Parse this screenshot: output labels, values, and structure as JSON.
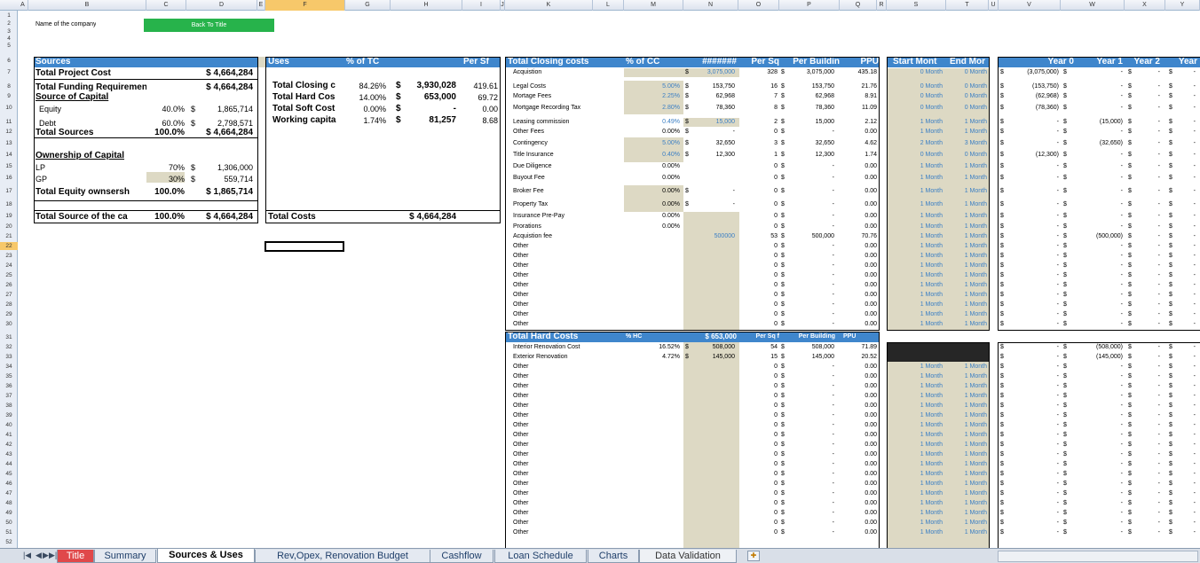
{
  "columns": [
    "A",
    "B",
    "C",
    "D",
    "E",
    "F",
    "G",
    "H",
    "I",
    "J",
    "K",
    "L",
    "M",
    "N",
    "O",
    "P",
    "Q",
    "R",
    "S",
    "T",
    "U",
    "V",
    "W",
    "X",
    "Y"
  ],
  "rows": [
    "1",
    "2",
    "3",
    "4",
    "5",
    "6",
    "7",
    "8",
    "9",
    "10",
    "11",
    "12",
    "13",
    "14",
    "15",
    "16",
    "17",
    "18",
    "19",
    "20",
    "21",
    "22",
    "23",
    "24",
    "25",
    "26",
    "27",
    "28",
    "29",
    "30",
    "31",
    "32",
    "33",
    "34",
    "35",
    "36",
    "37",
    "38",
    "39",
    "40",
    "41",
    "42",
    "43",
    "44",
    "45",
    "46",
    "47",
    "48",
    "49",
    "50",
    "51",
    "52"
  ],
  "company_label": "Name of the company",
  "back_button": "Back To Title",
  "sources": {
    "header": "Sources",
    "rows": [
      {
        "label": "Total Project Cost",
        "pct": "",
        "d": "",
        "val": "$ 4,664,284"
      },
      {
        "label": "Total Funding Requirement",
        "pct": "",
        "d": "",
        "val": "$ 4,664,284"
      },
      {
        "label": "Source of Capital",
        "pct": "",
        "d": "",
        "val": ""
      },
      {
        "label": "Equity",
        "pct": "40.0%",
        "d": "$",
        "val": "1,865,714"
      },
      {
        "label": "Debt",
        "pct": "60.0%",
        "d": "$",
        "val": "2,798,571"
      },
      {
        "label": "Total Sources",
        "pct": "100.0%",
        "d": "",
        "val": "$ 4,664,284"
      },
      {
        "label": "Ownership of Capital",
        "pct": "",
        "d": "",
        "val": ""
      },
      {
        "label": "LP",
        "pct": "70%",
        "d": "$",
        "val": "1,306,000"
      },
      {
        "label": "GP",
        "pct": "30%",
        "d": "$",
        "val": "559,714"
      },
      {
        "label": "Total Equity ownsersh",
        "pct": "100.0%",
        "d": "",
        "val": "$ 1,865,714"
      },
      {
        "label": "Total Source of the ca",
        "pct": "100.0%",
        "d": "",
        "val": "$ 4,664,284"
      }
    ]
  },
  "uses": {
    "header": "Uses",
    "pct_header": "% of TC",
    "persf_header": "Per Sf",
    "rows": [
      {
        "label": "Total Closing c",
        "pct": "84.26%",
        "d": "$",
        "val": "3,930,028",
        "psf": "419.61"
      },
      {
        "label": "Total Hard Cos",
        "pct": "14.00%",
        "d": "$",
        "val": "653,000",
        "psf": "69.72"
      },
      {
        "label": "Total Soft Cost",
        "pct": "0.00%",
        "d": "$",
        "val": "-",
        "psf": "0.00"
      },
      {
        "label": "Working capita",
        "pct": "1.74%",
        "d": "$",
        "val": "81,257",
        "psf": "8.68"
      }
    ],
    "total_label": "Total Costs",
    "total_val": "$ 4,664,284"
  },
  "closing": {
    "header": "Total Closing costs",
    "cols": [
      "% of CC",
      "#######",
      "Per Sq",
      "Per Buildin",
      "PPU"
    ],
    "rows": [
      {
        "label": "Acquistion",
        "pct": "",
        "d": "$",
        "amt": "3,075,000",
        "sq": "328",
        "d2": "$",
        "bld": "3,075,000",
        "ppu": "435.18"
      },
      {
        "label": "Legal Costs",
        "pct": "5.00%",
        "d": "$",
        "amt": "153,750",
        "sq": "16",
        "d2": "$",
        "bld": "153,750",
        "ppu": "21.76"
      },
      {
        "label": "Mortage Fees",
        "pct": "2.25%",
        "d": "$",
        "amt": "62,968",
        "sq": "7",
        "d2": "$",
        "bld": "62,968",
        "ppu": "8.91"
      },
      {
        "label": "Mortgage Recording Tax",
        "pct": "2.80%",
        "d": "$",
        "amt": "78,360",
        "sq": "8",
        "d2": "$",
        "bld": "78,360",
        "ppu": "11.09"
      },
      {
        "label": "Leasing commission",
        "pct": "0.49%",
        "d": "$",
        "amt": "15,000",
        "sq": "2",
        "d2": "$",
        "bld": "15,000",
        "ppu": "2.12"
      },
      {
        "label": "Other Fees",
        "pct": "0.00%",
        "d": "$",
        "amt": "-",
        "sq": "0",
        "d2": "$",
        "bld": "-",
        "ppu": "0.00"
      },
      {
        "label": "Contingency",
        "pct": "5.00%",
        "d": "$",
        "amt": "32,650",
        "sq": "3",
        "d2": "$",
        "bld": "32,650",
        "ppu": "4.62"
      },
      {
        "label": "Title Insurance",
        "pct": "0.40%",
        "d": "$",
        "amt": "12,300",
        "sq": "1",
        "d2": "$",
        "bld": "12,300",
        "ppu": "1.74"
      },
      {
        "label": "Due Diligence",
        "pct": "0.00%",
        "d": "",
        "amt": "",
        "sq": "0",
        "d2": "$",
        "bld": "-",
        "ppu": "0.00"
      },
      {
        "label": "Buyout Fee",
        "pct": "0.00%",
        "d": "",
        "amt": "",
        "sq": "0",
        "d2": "$",
        "bld": "-",
        "ppu": "0.00"
      },
      {
        "label": "Broker Fee",
        "pct": "0.00%",
        "d": "$",
        "amt": "-",
        "sq": "0",
        "d2": "$",
        "bld": "-",
        "ppu": "0.00"
      },
      {
        "label": "Property Tax",
        "pct": "0.00%",
        "d": "$",
        "amt": "-",
        "sq": "0",
        "d2": "$",
        "bld": "-",
        "ppu": "0.00"
      },
      {
        "label": "Insurance Pre-Pay",
        "pct": "0.00%",
        "d": "",
        "amt": "",
        "sq": "0",
        "d2": "$",
        "bld": "-",
        "ppu": "0.00"
      },
      {
        "label": "Prorations",
        "pct": "0.00%",
        "d": "",
        "amt": "",
        "sq": "0",
        "d2": "$",
        "bld": "-",
        "ppu": "0.00"
      },
      {
        "label": "Acquistion fee",
        "pct": "",
        "d": "",
        "amt": "500000",
        "sq": "53",
        "d2": "$",
        "bld": "500,000",
        "ppu": "70.76"
      },
      {
        "label": "Other",
        "pct": "",
        "d": "",
        "amt": "",
        "sq": "0",
        "d2": "$",
        "bld": "-",
        "ppu": "0.00"
      },
      {
        "label": "Other",
        "pct": "",
        "d": "",
        "amt": "",
        "sq": "0",
        "d2": "$",
        "bld": "-",
        "ppu": "0.00"
      },
      {
        "label": "Other",
        "pct": "",
        "d": "",
        "amt": "",
        "sq": "0",
        "d2": "$",
        "bld": "-",
        "ppu": "0.00"
      },
      {
        "label": "Other",
        "pct": "",
        "d": "",
        "amt": "",
        "sq": "0",
        "d2": "$",
        "bld": "-",
        "ppu": "0.00"
      },
      {
        "label": "Other",
        "pct": "",
        "d": "",
        "amt": "",
        "sq": "0",
        "d2": "$",
        "bld": "-",
        "ppu": "0.00"
      },
      {
        "label": "Other",
        "pct": "",
        "d": "",
        "amt": "",
        "sq": "0",
        "d2": "$",
        "bld": "-",
        "ppu": "0.00"
      },
      {
        "label": "Other",
        "pct": "",
        "d": "",
        "amt": "",
        "sq": "0",
        "d2": "$",
        "bld": "-",
        "ppu": "0.00"
      },
      {
        "label": "Other",
        "pct": "",
        "d": "",
        "amt": "",
        "sq": "0",
        "d2": "$",
        "bld": "-",
        "ppu": "0.00"
      },
      {
        "label": "Other",
        "pct": "",
        "d": "",
        "amt": "",
        "sq": "0",
        "d2": "$",
        "bld": "-",
        "ppu": "0.00"
      }
    ]
  },
  "hard": {
    "header": "Total Hard Costs",
    "cols": [
      "% HC",
      "$ 653,000",
      "Per Sq f",
      "Per Building",
      "PPU"
    ],
    "rows": [
      {
        "label": "Interior Renovation Cost",
        "pct": "16.52%",
        "d": "$",
        "amt": "508,000",
        "sq": "54",
        "d2": "$",
        "bld": "508,000",
        "ppu": "71.89"
      },
      {
        "label": "Exterior Renovation",
        "pct": "4.72%",
        "d": "$",
        "amt": "145,000",
        "sq": "15",
        "d2": "$",
        "bld": "145,000",
        "ppu": "20.52"
      },
      {
        "label": "Other",
        "pct": "",
        "d": "",
        "amt": "",
        "sq": "0",
        "d2": "$",
        "bld": "-",
        "ppu": "0.00"
      },
      {
        "label": "Other",
        "pct": "",
        "d": "",
        "amt": "",
        "sq": "0",
        "d2": "$",
        "bld": "-",
        "ppu": "0.00"
      },
      {
        "label": "Other",
        "pct": "",
        "d": "",
        "amt": "",
        "sq": "0",
        "d2": "$",
        "bld": "-",
        "ppu": "0.00"
      },
      {
        "label": "Other",
        "pct": "",
        "d": "",
        "amt": "",
        "sq": "0",
        "d2": "$",
        "bld": "-",
        "ppu": "0.00"
      },
      {
        "label": "Other",
        "pct": "",
        "d": "",
        "amt": "",
        "sq": "0",
        "d2": "$",
        "bld": "-",
        "ppu": "0.00"
      },
      {
        "label": "Other",
        "pct": "",
        "d": "",
        "amt": "",
        "sq": "0",
        "d2": "$",
        "bld": "-",
        "ppu": "0.00"
      },
      {
        "label": "Other",
        "pct": "",
        "d": "",
        "amt": "",
        "sq": "0",
        "d2": "$",
        "bld": "-",
        "ppu": "0.00"
      },
      {
        "label": "Other",
        "pct": "",
        "d": "",
        "amt": "",
        "sq": "0",
        "d2": "$",
        "bld": "-",
        "ppu": "0.00"
      },
      {
        "label": "Other",
        "pct": "",
        "d": "",
        "amt": "",
        "sq": "0",
        "d2": "$",
        "bld": "-",
        "ppu": "0.00"
      },
      {
        "label": "Other",
        "pct": "",
        "d": "",
        "amt": "",
        "sq": "0",
        "d2": "$",
        "bld": "-",
        "ppu": "0.00"
      },
      {
        "label": "Other",
        "pct": "",
        "d": "",
        "amt": "",
        "sq": "0",
        "d2": "$",
        "bld": "-",
        "ppu": "0.00"
      },
      {
        "label": "Other",
        "pct": "",
        "d": "",
        "amt": "",
        "sq": "0",
        "d2": "$",
        "bld": "-",
        "ppu": "0.00"
      },
      {
        "label": "Other",
        "pct": "",
        "d": "",
        "amt": "",
        "sq": "0",
        "d2": "$",
        "bld": "-",
        "ppu": "0.00"
      },
      {
        "label": "Other",
        "pct": "",
        "d": "",
        "amt": "",
        "sq": "0",
        "d2": "$",
        "bld": "-",
        "ppu": "0.00"
      },
      {
        "label": "Other",
        "pct": "",
        "d": "",
        "amt": "",
        "sq": "0",
        "d2": "$",
        "bld": "-",
        "ppu": "0.00"
      },
      {
        "label": "Other",
        "pct": "",
        "d": "",
        "amt": "",
        "sq": "0",
        "d2": "$",
        "bld": "-",
        "ppu": "0.00"
      },
      {
        "label": "Other",
        "pct": "",
        "d": "",
        "amt": "",
        "sq": "0",
        "d2": "$",
        "bld": "-",
        "ppu": "0.00"
      },
      {
        "label": "Other",
        "pct": "",
        "d": "",
        "amt": "",
        "sq": "0",
        "d2": "$",
        "bld": "-",
        "ppu": "0.00"
      }
    ]
  },
  "timing": {
    "start_header": "Start Mont",
    "end_header": "End Mor",
    "closing": [
      [
        "0 Month",
        "0 Month"
      ],
      [
        "0 Month",
        "0 Month"
      ],
      [
        "0 Month",
        "0 Month"
      ],
      [
        "0 Month",
        "0 Month"
      ],
      [
        "1 Month",
        "1 Month"
      ],
      [
        "1 Month",
        "1 Month"
      ],
      [
        "2 Month",
        "3 Month"
      ],
      [
        "0 Month",
        "0 Month"
      ],
      [
        "1 Month",
        "1 Month"
      ],
      [
        "1 Month",
        "1 Month"
      ],
      [
        "1 Month",
        "1 Month"
      ],
      [
        "1 Month",
        "1 Month"
      ],
      [
        "1 Month",
        "1 Month"
      ],
      [
        "1 Month",
        "1 Month"
      ],
      [
        "1 Month",
        "1 Month"
      ],
      [
        "1 Month",
        "1 Month"
      ],
      [
        "1 Month",
        "1 Month"
      ],
      [
        "1 Month",
        "1 Month"
      ],
      [
        "1 Month",
        "1 Month"
      ],
      [
        "1 Month",
        "1 Month"
      ],
      [
        "1 Month",
        "1 Month"
      ],
      [
        "1 Month",
        "1 Month"
      ],
      [
        "1 Month",
        "1 Month"
      ],
      [
        "1 Month",
        "1 Month"
      ]
    ],
    "hard": [
      [
        "",
        ""
      ],
      [
        "",
        ""
      ],
      [
        "1 Month",
        "1 Month"
      ],
      [
        "1 Month",
        "1 Month"
      ],
      [
        "1 Month",
        "1 Month"
      ],
      [
        "1 Month",
        "1 Month"
      ],
      [
        "1 Month",
        "1 Month"
      ],
      [
        "1 Month",
        "1 Month"
      ],
      [
        "1 Month",
        "1 Month"
      ],
      [
        "1 Month",
        "1 Month"
      ],
      [
        "1 Month",
        "1 Month"
      ],
      [
        "1 Month",
        "1 Month"
      ],
      [
        "1 Month",
        "1 Month"
      ],
      [
        "1 Month",
        "1 Month"
      ],
      [
        "1 Month",
        "1 Month"
      ],
      [
        "1 Month",
        "1 Month"
      ],
      [
        "1 Month",
        "1 Month"
      ],
      [
        "1 Month",
        "1 Month"
      ],
      [
        "1 Month",
        "1 Month"
      ],
      [
        "1 Month",
        "1 Month"
      ]
    ]
  },
  "years": {
    "headers": [
      "Year 0",
      "Year 1",
      "Year 2",
      "Year"
    ],
    "closing": [
      [
        "(3,075,000)",
        "-"
      ],
      [
        "(153,750)",
        "-"
      ],
      [
        "(62,968)",
        "-"
      ],
      [
        "(78,360)",
        "-"
      ],
      [
        "-",
        "(15,000)"
      ],
      [
        "-",
        "-"
      ],
      [
        "-",
        "(32,650)"
      ],
      [
        "(12,300)",
        "-"
      ],
      [
        "-",
        "-"
      ],
      [
        "-",
        "-"
      ],
      [
        "-",
        "-"
      ],
      [
        "-",
        "-"
      ],
      [
        "-",
        "-"
      ],
      [
        "-",
        "-"
      ],
      [
        "-",
        "(500,000)"
      ],
      [
        "-",
        "-"
      ],
      [
        "-",
        "-"
      ],
      [
        "-",
        "-"
      ],
      [
        "-",
        "-"
      ],
      [
        "-",
        "-"
      ],
      [
        "-",
        "-"
      ],
      [
        "-",
        "-"
      ],
      [
        "-",
        "-"
      ],
      [
        "-",
        "-"
      ]
    ],
    "hard": [
      [
        "-",
        "(508,000)"
      ],
      [
        "-",
        "(145,000)"
      ],
      [
        "-",
        "-"
      ],
      [
        "-",
        "-"
      ],
      [
        "-",
        "-"
      ],
      [
        "-",
        "-"
      ],
      [
        "-",
        "-"
      ],
      [
        "-",
        "-"
      ],
      [
        "-",
        "-"
      ],
      [
        "-",
        "-"
      ],
      [
        "-",
        "-"
      ],
      [
        "-",
        "-"
      ],
      [
        "-",
        "-"
      ],
      [
        "-",
        "-"
      ],
      [
        "-",
        "-"
      ],
      [
        "-",
        "-"
      ],
      [
        "-",
        "-"
      ],
      [
        "-",
        "-"
      ],
      [
        "-",
        "-"
      ],
      [
        "-",
        "-"
      ]
    ]
  },
  "tabs": [
    "Title",
    "Summary",
    "Sources & Uses",
    "Rev,Opex, Renovation Budget",
    "Cashflow",
    "Loan Schedule",
    "Charts",
    "Data Validation"
  ],
  "colors": {
    "header_blue": "#3f86cc",
    "tan": "#ddd9c4",
    "green_button": "#27b34b",
    "value_blue": "#3b7fc4",
    "title_tab": "#e0484a"
  }
}
